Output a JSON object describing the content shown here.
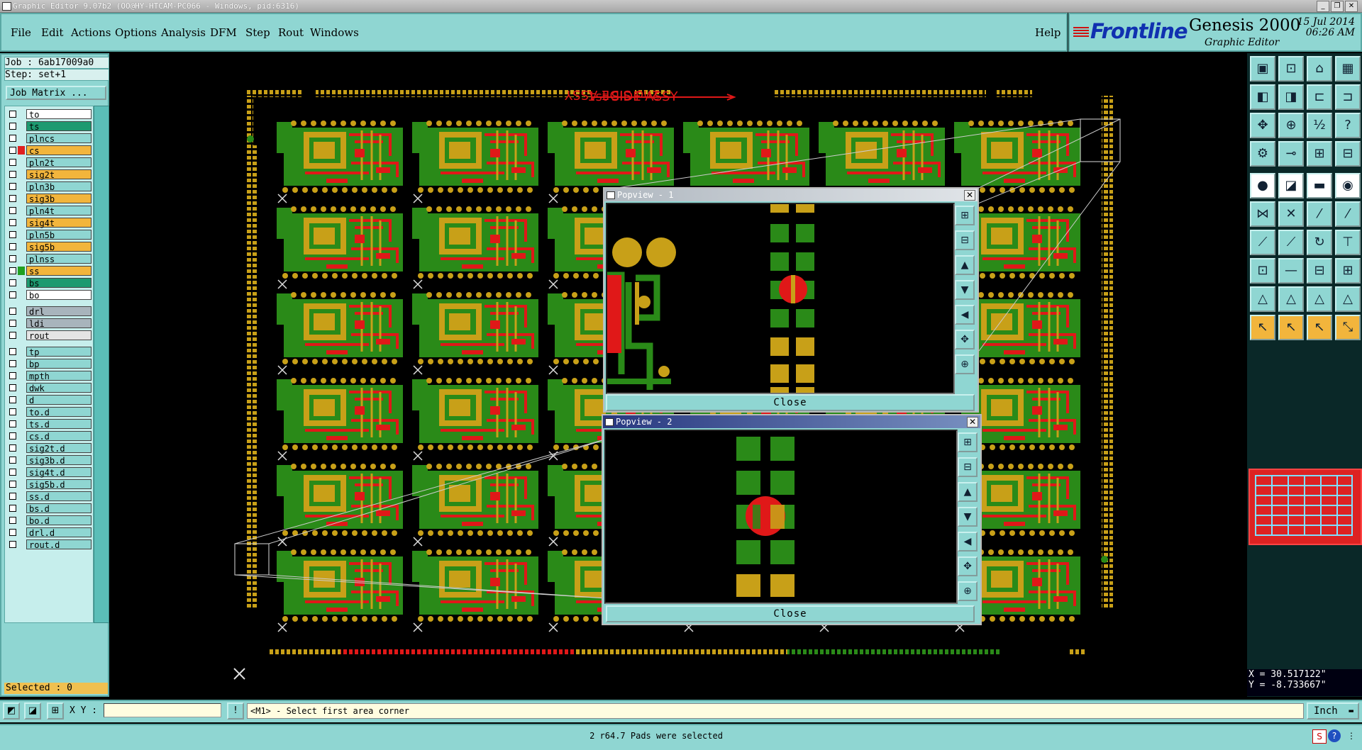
{
  "window": {
    "title": "Graphic Editor 9.07b2 (OO@HY-HTCAM-PC066 - Windows, pid:6316)",
    "controls": [
      "_",
      "❐",
      "✕"
    ]
  },
  "menu": {
    "items": [
      "File",
      "Edit",
      "Actions",
      "Options",
      "Analysis",
      "DFM",
      "Step",
      "Rout",
      "Windows"
    ],
    "help": "Help"
  },
  "brand": {
    "logo": "Frontline",
    "product": "Genesis 2000",
    "subtitle": "Graphic Editor",
    "date": "15 Jul 2014",
    "time": "06:26 AM"
  },
  "job": {
    "job_label": "Job : 6ab17009a0",
    "step_label": "Step: set+1",
    "job_matrix": "Job Matrix ...",
    "selected": "Selected : 0"
  },
  "layers": [
    {
      "name": "to",
      "color": "#ffffff",
      "swatch": ""
    },
    {
      "name": "ts",
      "color": "#1d9a70",
      "swatch": ""
    },
    {
      "name": "plncs",
      "color": "#8fd6d2",
      "swatch": ""
    },
    {
      "name": "cs",
      "color": "#f2b53c",
      "swatch": "#e02020"
    },
    {
      "name": "pln2t",
      "color": "#8fd6d2",
      "swatch": ""
    },
    {
      "name": "sig2t",
      "color": "#f2b53c",
      "swatch": ""
    },
    {
      "name": "pln3b",
      "color": "#8fd6d2",
      "swatch": ""
    },
    {
      "name": "sig3b",
      "color": "#f2b53c",
      "swatch": ""
    },
    {
      "name": "pln4t",
      "color": "#8fd6d2",
      "swatch": ""
    },
    {
      "name": "sig4t",
      "color": "#f2b53c",
      "swatch": ""
    },
    {
      "name": "pln5b",
      "color": "#8fd6d2",
      "swatch": ""
    },
    {
      "name": "sig5b",
      "color": "#f2b53c",
      "swatch": ""
    },
    {
      "name": "plnss",
      "color": "#8fd6d2",
      "swatch": ""
    },
    {
      "name": "ss",
      "color": "#f2b53c",
      "swatch": "#20a020"
    },
    {
      "name": "bs",
      "color": "#1d9a70",
      "swatch": ""
    },
    {
      "name": "bo",
      "color": "#ffffff",
      "swatch": ""
    },
    {
      "name": "drl",
      "color": "#a8b4bc",
      "swatch": ""
    },
    {
      "name": "ldi",
      "color": "#a8b4bc",
      "swatch": ""
    },
    {
      "name": "rout",
      "color": "#e4e4e4",
      "swatch": ""
    },
    {
      "name": "tp",
      "color": "#8fd6d2",
      "swatch": ""
    },
    {
      "name": "bp",
      "color": "#8fd6d2",
      "swatch": ""
    },
    {
      "name": "mpth",
      "color": "#8fd6d2",
      "swatch": ""
    },
    {
      "name": "dwk",
      "color": "#8fd6d2",
      "swatch": ""
    },
    {
      "name": "d",
      "color": "#8fd6d2",
      "swatch": ""
    },
    {
      "name": "to.d",
      "color": "#8fd6d2",
      "swatch": ""
    },
    {
      "name": "ts.d",
      "color": "#8fd6d2",
      "swatch": ""
    },
    {
      "name": "cs.d",
      "color": "#8fd6d2",
      "swatch": ""
    },
    {
      "name": "sig2t.d",
      "color": "#8fd6d2",
      "swatch": ""
    },
    {
      "name": "sig3b.d",
      "color": "#8fd6d2",
      "swatch": ""
    },
    {
      "name": "sig4t.d",
      "color": "#8fd6d2",
      "swatch": ""
    },
    {
      "name": "sig5b.d",
      "color": "#8fd6d2",
      "swatch": ""
    },
    {
      "name": "ss.d",
      "color": "#8fd6d2",
      "swatch": ""
    },
    {
      "name": "bs.d",
      "color": "#8fd6d2",
      "swatch": ""
    },
    {
      "name": "bo.d",
      "color": "#8fd6d2",
      "swatch": ""
    },
    {
      "name": "drl.d",
      "color": "#8fd6d2",
      "swatch": ""
    },
    {
      "name": "rout.d",
      "color": "#8fd6d2",
      "swatch": ""
    }
  ],
  "canvas": {
    "side_label_1": "1st SIDE ASSY",
    "side_label_2": "2nd SIDE ASSY"
  },
  "popview1": {
    "title": "Popview - 1",
    "close": "Close",
    "close_box": "✕"
  },
  "popview2": {
    "title": "Popview - 2",
    "close": "Close",
    "close_box": "✕"
  },
  "coords": {
    "x": "X = 30.517122\"",
    "y": "Y = -8.733667\""
  },
  "command": {
    "xy_label": "X Y :",
    "xy_value": "",
    "prompt": "<M1> - Select first area corner",
    "unit": "Inch"
  },
  "status": {
    "message": "2 r64.7 Pads were selected"
  },
  "colors": {
    "panel": "#8fd6d2",
    "pad_gold": "#c8a018",
    "trace_green": "#2a8a18",
    "highlight_red": "#e01818"
  }
}
